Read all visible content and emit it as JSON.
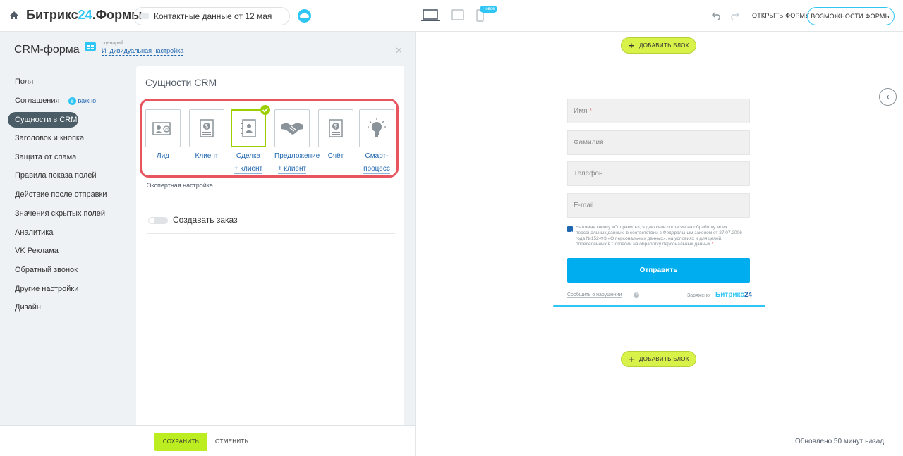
{
  "header": {
    "brand_prefix": "Битрикс",
    "brand_num": "24",
    "brand_suffix": ".Формы",
    "form_title": "Контактные данные от 12 мая",
    "new_badge": "Новое",
    "open_form": "ОТКРЫТЬ ФОРМУ",
    "features": "ВОЗМОЖНОСТИ ФОРМЫ"
  },
  "left": {
    "title": "CRM-форма",
    "scenario_caption": "сценарий",
    "scenario_value": "Индивидуальная настройка",
    "nav": [
      {
        "label": "Поля"
      },
      {
        "label": "Соглашения",
        "info": "i",
        "info_text": "важно"
      },
      {
        "label": "Сущности в CRM",
        "active": true
      },
      {
        "label": "Заголовок и кнопка"
      },
      {
        "label": "Защита от спама"
      },
      {
        "label": "Правила показа полей"
      },
      {
        "label": "Действие после отправки"
      },
      {
        "label": "Значения скрытых полей"
      },
      {
        "label": "Аналитика"
      },
      {
        "label": "VK Реклама"
      },
      {
        "label": "Обратный звонок"
      },
      {
        "label": "Другие настройки"
      },
      {
        "label": "Дизайн"
      }
    ],
    "section_title": "Сущности CRM",
    "entities": [
      {
        "line1": "Лид",
        "line2": "",
        "icon": "lead-icon"
      },
      {
        "line1": "Клиент",
        "line2": "",
        "icon": "client-icon"
      },
      {
        "line1": "Сделка",
        "line2": "+ клиент",
        "icon": "deal-icon",
        "selected": true
      },
      {
        "line1": "Предложение",
        "line2": "+ клиент",
        "icon": "handshake-icon"
      },
      {
        "line1": "Счёт",
        "line2": "",
        "icon": "invoice-icon"
      },
      {
        "line1": "Смарт-",
        "line2": "процесс",
        "icon": "lightbulb-icon"
      }
    ],
    "expert": "Экспертная настройка",
    "create_order": "Создавать заказ",
    "save": "СОХРАНИТЬ",
    "cancel": "ОТМЕНИТЬ"
  },
  "preview": {
    "add_block": "ДОБАВИТЬ БЛОК",
    "fields": [
      {
        "placeholder": "Имя",
        "required": "*"
      },
      {
        "placeholder": "Фамилия",
        "required": ""
      },
      {
        "placeholder": "Телефон",
        "required": ""
      },
      {
        "placeholder": "E-mail",
        "required": ""
      }
    ],
    "consent_text": "Нажимая кнопку «Отправить», я даю свое согласие на обработку моих персональных данных, в соответствии с Федеральным законом от 27.07.2006 года №152-ФЗ «О персональных данных», на условиях и для целей, определенных в Согласии на обработку персональных данных",
    "consent_req": "*",
    "submit": "Отправить",
    "report": "Сообщить о нарушении",
    "help": "?",
    "charged": "Заряжено",
    "b24_word": "Битрикс",
    "b24_num": "24",
    "updated": "Обновлено 50 минут назад"
  },
  "colors": {
    "accent": "#2fc6f6",
    "link": "#2067b0",
    "save_green": "#bbed21",
    "highlight_red": "#e8555e",
    "selected_green": "#9dcf00"
  }
}
